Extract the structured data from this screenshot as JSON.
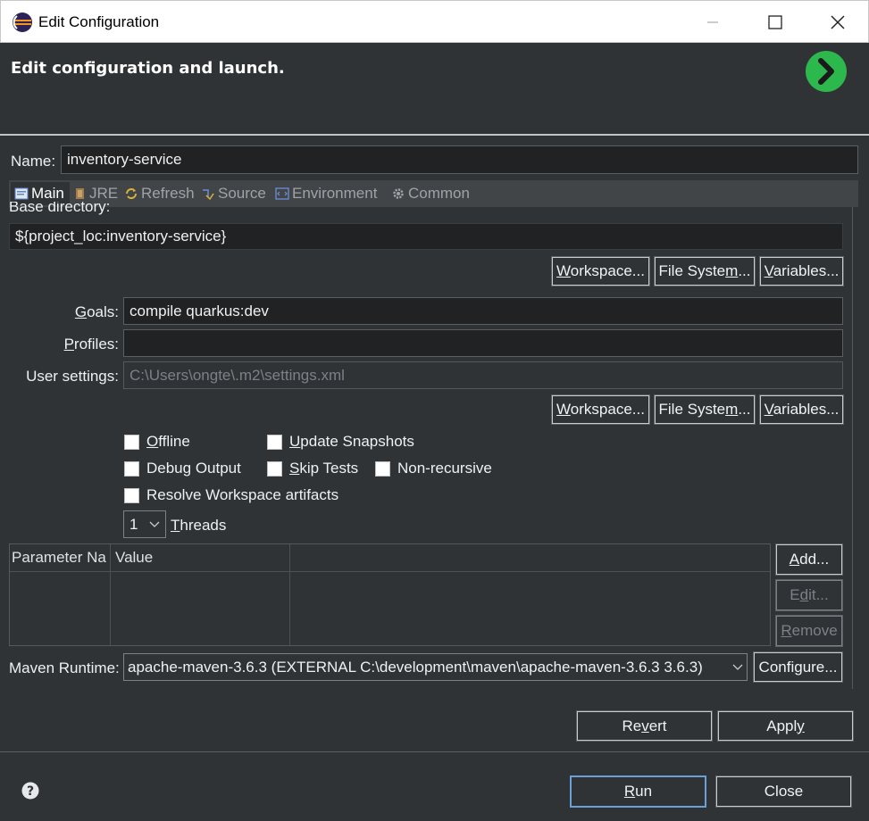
{
  "window": {
    "title": "Edit Configuration"
  },
  "banner": {
    "title": "Edit configuration and launch."
  },
  "name": {
    "label": "Name:",
    "value": "inventory-service"
  },
  "tabs": [
    {
      "label": "Main",
      "active": true
    },
    {
      "label": "JRE",
      "active": false
    },
    {
      "label": "Refresh",
      "active": false
    },
    {
      "label": "Source",
      "active": false
    },
    {
      "label": "Environment",
      "active": false
    },
    {
      "label": "Common",
      "active": false
    }
  ],
  "base_directory": {
    "label": "Base directory:",
    "value": "${project_loc:inventory-service}",
    "buttons": [
      "Workspace...",
      "File System...",
      "Variables..."
    ]
  },
  "goals": {
    "label": "Goals:",
    "value": "compile quarkus:dev"
  },
  "profiles": {
    "label": "Profiles:",
    "value": ""
  },
  "user_settings": {
    "label": "User settings:",
    "placeholder": "C:\\Users\\ongte\\.m2\\settings.xml",
    "buttons": [
      "Workspace...",
      "File System...",
      "Variables..."
    ]
  },
  "options": {
    "offline": "Offline",
    "update_snapshots": "Update Snapshots",
    "debug_output": "Debug Output",
    "skip_tests": "Skip Tests",
    "non_recursive": "Non-recursive",
    "resolve_workspace": "Resolve Workspace artifacts"
  },
  "threads": {
    "value": "1",
    "label": "Threads"
  },
  "parameters": {
    "columns": [
      "Parameter Na",
      "Value"
    ],
    "buttons": {
      "add": "Add...",
      "edit": "Edit...",
      "remove": "Remove"
    }
  },
  "maven_runtime": {
    "label": "Maven Runtime:",
    "value": "apache-maven-3.6.3 (EXTERNAL C:\\development\\maven\\apache-maven-3.6.3 3.6.3)",
    "configure": "Configure..."
  },
  "actions": {
    "revert": "Revert",
    "apply": "Apply",
    "run": "Run",
    "close": "Close"
  },
  "colors": {
    "background": "#2f3336",
    "field": "#202224",
    "accent_green": "#2db84d"
  }
}
